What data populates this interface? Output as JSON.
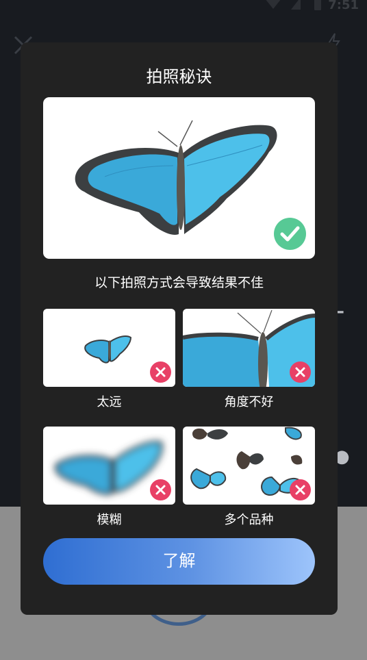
{
  "status_bar": {
    "time": "7:51"
  },
  "dialog": {
    "title": "拍照秘诀",
    "subtitle": "以下拍照方式会导致结果不佳",
    "examples": [
      {
        "label": "太远"
      },
      {
        "label": "角度不好"
      },
      {
        "label": "模糊"
      },
      {
        "label": "多个品种"
      }
    ],
    "confirm_label": "了解"
  },
  "colors": {
    "dialog_bg": "#222222",
    "check_green": "#57c995",
    "error_red": "#e84066",
    "button_start": "#2f6ed2",
    "button_end": "#9dc4fb"
  },
  "icons": [
    "close-icon",
    "flash-icon",
    "check-icon",
    "cross-icon",
    "wifi-icon",
    "signal-icon",
    "battery-icon"
  ]
}
